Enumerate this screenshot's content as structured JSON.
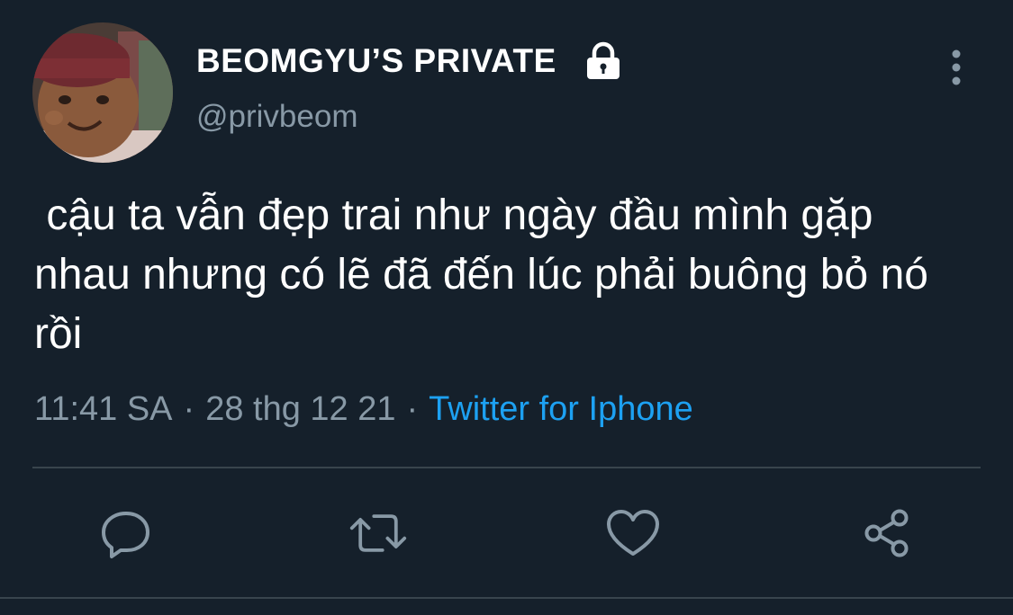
{
  "user": {
    "display_name": "BEOMGYU’S PRIVATE",
    "handle": "@privbeom",
    "protected_icon": "lock-icon",
    "avatar_icon": "avatar"
  },
  "tweet": {
    "text": " cậu ta vẫn đẹp trai như ngày đầu mình gặp nhau nhưng có lẽ đã đến lúc phải buông bỏ nó rồi",
    "time": "11:41 SA",
    "date": "28 thg 12 21",
    "separator": "·",
    "source": "Twitter for Iphone"
  },
  "actions": {
    "reply_icon": "reply-icon",
    "retweet_icon": "retweet-icon",
    "like_icon": "heart-icon",
    "share_icon": "share-icon",
    "more_icon": "more-vertical-icon"
  },
  "colors": {
    "background": "#15202b",
    "primary_text": "#ffffff",
    "secondary_text": "#8899a6",
    "accent": "#1da1f2",
    "divider": "#38444d"
  }
}
